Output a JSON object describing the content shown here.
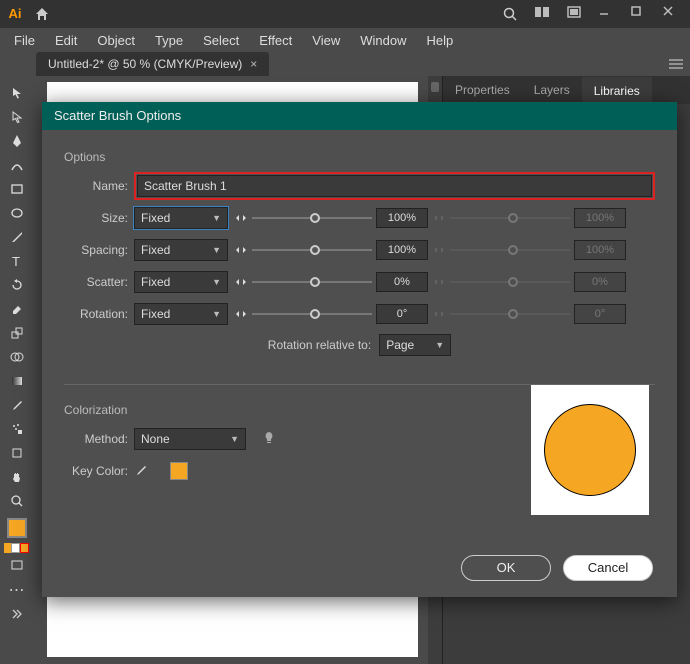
{
  "app": {
    "icon_text": "Ai"
  },
  "menubar": [
    "File",
    "Edit",
    "Object",
    "Type",
    "Select",
    "Effect",
    "View",
    "Window",
    "Help"
  ],
  "doctab": {
    "title": "Untitled-2* @ 50 % (CMYK/Preview)"
  },
  "panels": {
    "tabs": [
      "Properties",
      "Layers",
      "Libraries"
    ],
    "active": 2
  },
  "dialog": {
    "title": "Scatter Brush Options",
    "options_label": "Options",
    "name_label": "Name:",
    "name_value": "Scatter Brush 1",
    "rows": {
      "size": {
        "label": "Size:",
        "mode": "Fixed",
        "val1": "100%",
        "val2": "100%"
      },
      "spacing": {
        "label": "Spacing:",
        "mode": "Fixed",
        "val1": "100%",
        "val2": "100%"
      },
      "scatter": {
        "label": "Scatter:",
        "mode": "Fixed",
        "val1": "0%",
        "val2": "0%"
      },
      "rotation": {
        "label": "Rotation:",
        "mode": "Fixed",
        "val1": "0°",
        "val2": "0°"
      }
    },
    "rotation_relative_label": "Rotation relative to:",
    "rotation_relative_value": "Page",
    "colorization_label": "Colorization",
    "method_label": "Method:",
    "method_value": "None",
    "key_color_label": "Key Color:",
    "ok": "OK",
    "cancel": "Cancel"
  },
  "colors": {
    "accent": "#f5a623",
    "dialog_title_bg": "#005f56"
  }
}
